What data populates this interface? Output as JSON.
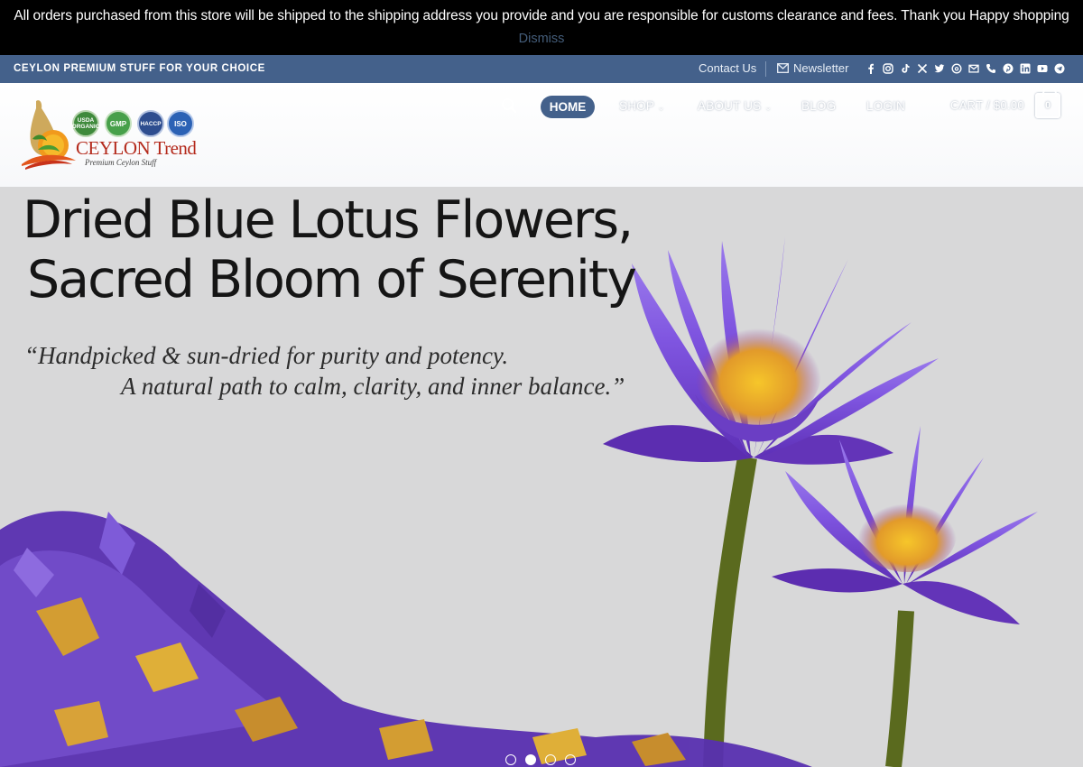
{
  "notice": {
    "text": "All orders purchased from this store will be shipped to the shipping address you provide and you are responsible for customs clearance and fees. Thank you Happy shopping",
    "dismiss": "Dismiss"
  },
  "topbar": {
    "tagline": "CEYLON PREMIUM STUFF FOR YOUR CHOICE",
    "contact": "Contact Us",
    "newsletter": "Newsletter",
    "socials": [
      "facebook-icon",
      "instagram-icon",
      "tiktok-icon",
      "x-icon",
      "twitter-icon",
      "threads-icon",
      "email-icon",
      "phone-icon",
      "pinterest-icon",
      "linkedin-icon",
      "youtube-icon",
      "telegram-icon"
    ]
  },
  "logo": {
    "name": "CEYLON Trend",
    "tagline": "Premium Ceylon Stuff",
    "certs": [
      "USDA ORGANIC",
      "GMP",
      "HACCP",
      "ISO"
    ]
  },
  "nav": {
    "home": "HOME",
    "shop": "SHOP",
    "about": "ABOUT US",
    "blog": "BLOG",
    "login": "LOGIN",
    "cart": "CART / $0.00",
    "cart_count": "0"
  },
  "hero": {
    "title_line1": "Dried Blue Lotus Flowers,",
    "title_line2": "Sacred Bloom of Serenity",
    "quote_line1": "“Handpicked & sun-dried for purity and potency.",
    "quote_line2": "A natural path to calm, clarity, and inner balance.”",
    "slides": 4,
    "active_slide": 2
  },
  "colors": {
    "brand": "#44618b",
    "notice_bg": "#000000",
    "hero_bg": "#d8d8d9"
  }
}
